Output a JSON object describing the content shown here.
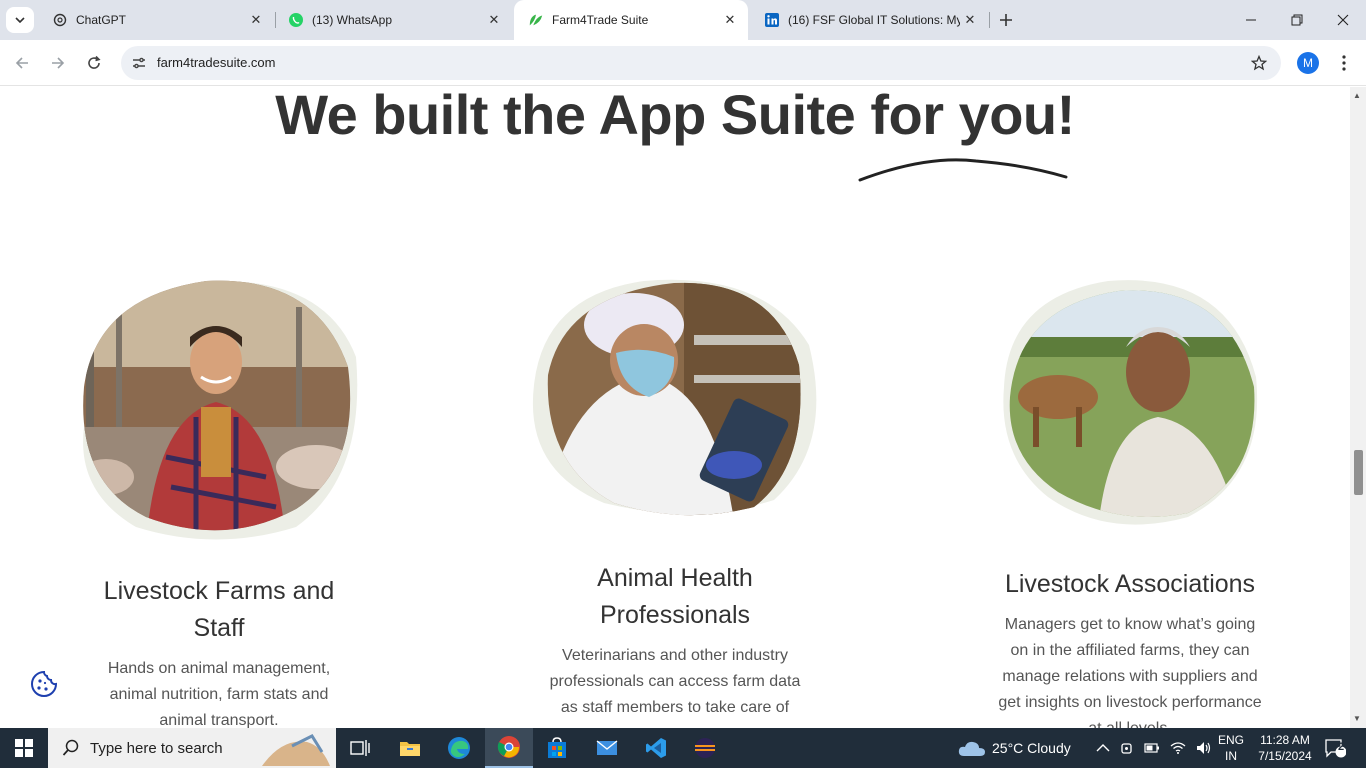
{
  "browser": {
    "tabs": [
      {
        "title": "ChatGPT",
        "icon": "chatgpt-icon"
      },
      {
        "title": "(13) WhatsApp",
        "icon": "whatsapp-icon"
      },
      {
        "title": "Farm4Trade Suite",
        "icon": "farm4trade-leaf-icon",
        "active": true
      },
      {
        "title": "(16) FSF Global IT Solutions: My",
        "icon": "linkedin-icon"
      }
    ],
    "url": "farm4tradesuite.com",
    "profile_initial": "M"
  },
  "page": {
    "headline": "We built the App Suite for you!",
    "cards": [
      {
        "title": "Livestock Farms and Staff",
        "description": "Hands on animal management, animal nutrition, farm stats and animal transport.",
        "image": "farmer-in-pig-barn"
      },
      {
        "title": "Animal Health Professionals",
        "description": "Veterinarians and other industry professionals can access farm data as staff members to take care of",
        "image": "veterinarian-with-tablet"
      },
      {
        "title": "Livestock Associations",
        "description": "Managers get to know what’s going on in the affiliated farms, they can manage relations with suppliers and get insights on livestock performance at all levels.",
        "image": "rancher-with-cattle"
      }
    ]
  },
  "taskbar": {
    "search_placeholder": "Type here to search",
    "weather": "25°C  Cloudy",
    "language": "ENG",
    "region": "IN",
    "time": "11:28 AM",
    "date": "7/15/2024",
    "notifications": "2"
  },
  "colors": {
    "tabbar_bg": "#dfe3eb",
    "heading_text": "#333333",
    "blob_cream": "#eceee6",
    "taskbar_bg": "#202d3a",
    "whatsapp_green": "#25d366",
    "linkedin_blue": "#0a66c2",
    "farm_leaf_green": "#39b54a",
    "cookie_blue": "#1e40af"
  }
}
